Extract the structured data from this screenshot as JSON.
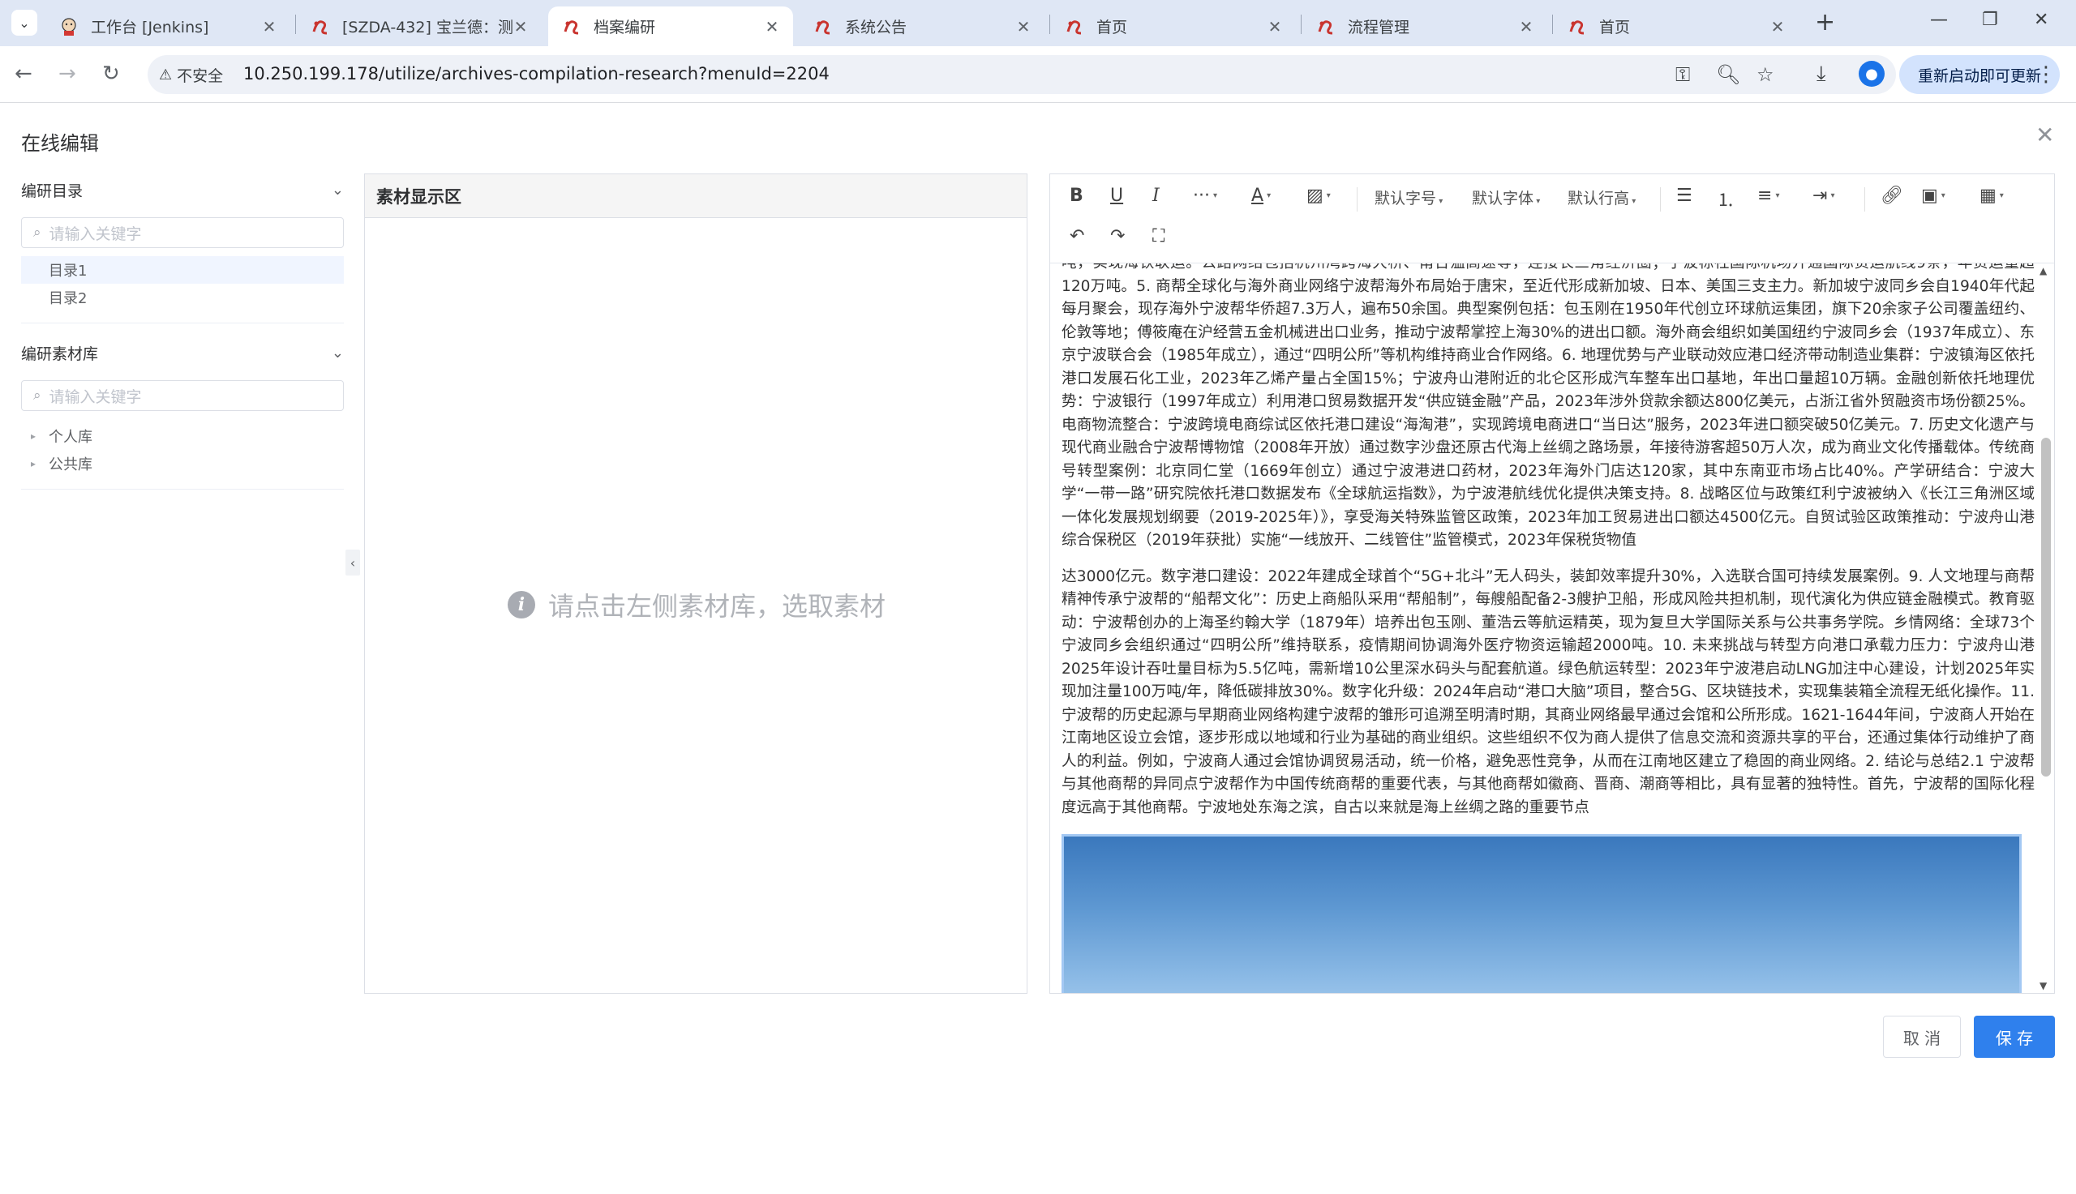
{
  "browser": {
    "tabs": [
      {
        "title": "工作台 [Jenkins]",
        "icon": "jenkins-icon",
        "active": false
      },
      {
        "title": "[SZDA-432] 宝兰德：测",
        "icon": "project-logo-icon",
        "active": false
      },
      {
        "title": "档案编研",
        "icon": "project-logo-icon",
        "active": true
      },
      {
        "title": "系统公告",
        "icon": "project-logo-icon",
        "active": false
      },
      {
        "title": "首页",
        "icon": "project-logo-icon",
        "active": false
      },
      {
        "title": "流程管理",
        "icon": "project-logo-icon",
        "active": false
      },
      {
        "title": "首页",
        "icon": "project-logo-icon",
        "active": false
      }
    ],
    "security_label": "不安全",
    "url": "10.250.199.178/utilize/archives-compilation-research?menuId=2204",
    "restart_label": "重新启动即可更新"
  },
  "dialog": {
    "title": "在线编辑",
    "catalog": {
      "title": "编研目录",
      "search_placeholder": "请输入关键字",
      "items": [
        "目录1",
        "目录2"
      ]
    },
    "library": {
      "title": "编研素材库",
      "search_placeholder": "请输入关键字",
      "items": [
        "个人库",
        "公共库"
      ]
    },
    "material": {
      "title": "素材显示区",
      "empty_hint": "请点击左侧素材库，选取素材"
    },
    "editor": {
      "font_size_label": "默认字号",
      "font_family_label": "默认字体",
      "line_height_label": "默认行高",
      "paragraphs": [
        "吨，实现海铁联运。公路网络包括杭州湾跨海大桥、甬台温高速等，连接长三角经济圈；宁波栎社国际机场开通国际货运航线9条，年货运量超120万吨。5. 商帮全球化与海外商业网络宁波帮海外布局始于唐宋，至近代形成新加坡、日本、美国三支主力。新加坡宁波同乡会自1940年代起每月聚会，现存海外宁波帮华侨超7.3万人，遍布50余国。典型案例包括：包玉刚在1950年代创立环球航运集团，旗下20余家子公司覆盖纽约、伦敦等地；傅筱庵在沪经营五金机械进出口业务，推动宁波帮掌控上海30%的进出口额。海外商会组织如美国纽约宁波同乡会（1937年成立）、东京宁波联合会（1985年成立），通过“四明公所”等机构维持商业合作网络。6. 地理优势与产业联动效应港口经济带动制造业集群：宁波镇海区依托港口发展石化工业，2023年乙烯产量占全国15%；宁波舟山港附近的北仑区形成汽车整车出口基地，年出口量超10万辆。金融创新依托地理优势：宁波银行（1997年成立）利用港口贸易数据开发“供应链金融”产品，2023年涉外贷款余额达800亿美元，占浙江省外贸融资市场份额25%。电商物流整合：宁波跨境电商综试区依托港口建设“海淘港”，实现跨境电商进口“当日达”服务，2023年进口额突破50亿美元。7. 历史文化遗产与现代商业融合宁波帮博物馆（2008年开放）通过数字沙盘还原古代海上丝绸之路场景，年接待游客超50万人次，成为商业文化传播载体。传统商号转型案例：北京同仁堂（1669年创立）通过宁波港进口药材，2023年海外门店达120家，其中东南亚市场占比40%。产学研结合：宁波大学“一带一路”研究院依托港口数据发布《全球航运指数》，为宁波港航线优化提供决策支持。8. 战略区位与政策红利宁波被纳入《长江三角洲区域一体化发展规划纲要（2019-2025年）》，享受海关特殊监管区政策，2023年加工贸易进出口额达4500亿元。自贸试验区政策推动：宁波舟山港综合保税区（2019年获批）实施“一线放开、二线管住”监管模式，2023年保税货物值",
        "达3000亿元。数字港口建设：2022年建成全球首个“5G+北斗”无人码头，装卸效率提升30%，入选联合国可持续发展案例。9. 人文地理与商帮精神传承宁波帮的“船帮文化”：历史上商船队采用“帮船制”，每艘船配备2-3艘护卫船，形成风险共担机制，现代演化为供应链金融模式。教育驱动：宁波帮创办的上海圣约翰大学（1879年）培养出包玉刚、董浩云等航运精英，现为复旦大学国际关系与公共事务学院。乡情网络：全球73个宁波同乡会组织通过“四明公所”维持联系，疫情期间协调海外医疗物资运输超2000吨。10. 未来挑战与转型方向港口承载力压力：宁波舟山港2025年设计吞吐量目标为5.5亿吨，需新增10公里深水码头与配套航道。绿色航运转型：2023年宁波港启动LNG加注中心建设，计划2025年实现加注量100万吨/年，降低碳排放30%。数字化升级：2024年启动“港口大脑”项目，整合5G、区块链技术，实现集装箱全流程无纸化操作。11. 宁波帮的历史起源与早期商业网络构建宁波帮的雏形可追溯至明清时期，其商业网络最早通过会馆和公所形成。1621-1644年间，宁波商人开始在江南地区设立会馆，逐步形成以地域和行业为基础的商业组织。这些组织不仅为商人提供了信息交流和资源共享的平台，还通过集体行动维护了商人的利益。例如，宁波商人通过会馆协调贸易活动，统一价格，避免恶性竞争，从而在江南地区建立了稳固的商业网络。2. 结论与总结2.1 宁波帮与其他商帮的异同点宁波帮作为中国传统商帮的重要代表，与其他商帮如徽商、晋商、潮商等相比，具有显著的独特性。首先，宁波帮的国际化程度远高于其他商帮。宁波地处东海之滨，自古以来就是海上丝绸之路的重要节点"
      ]
    },
    "cancel_label": "取 消",
    "save_label": "保 存"
  }
}
